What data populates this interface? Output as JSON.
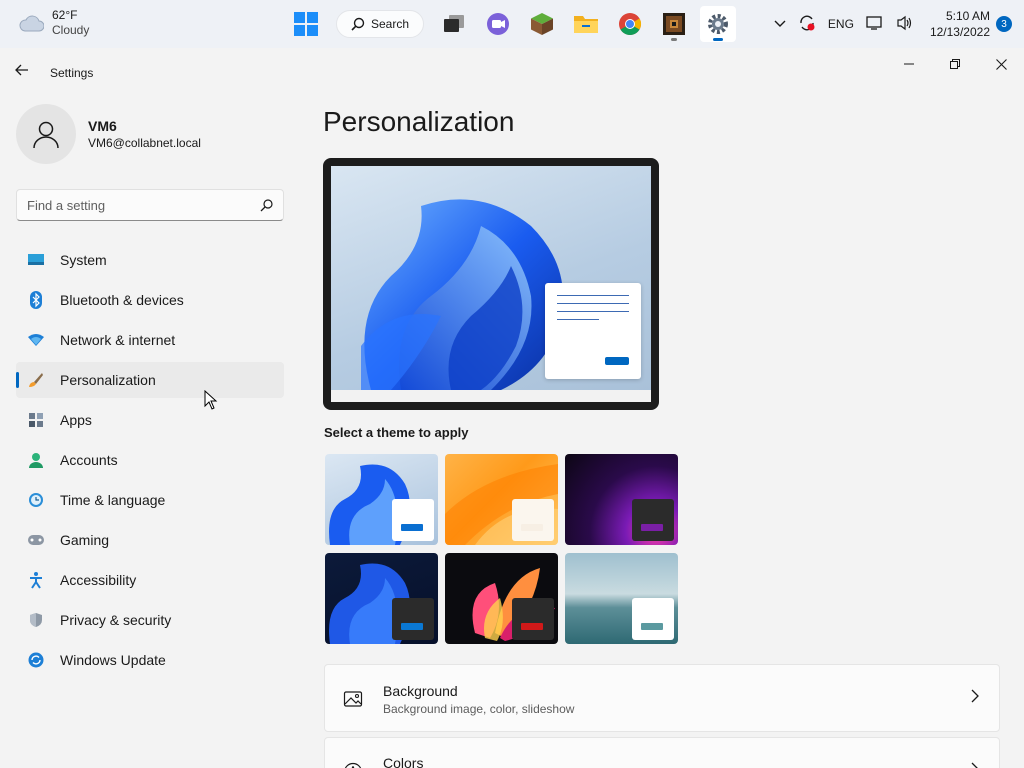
{
  "taskbar": {
    "weather": {
      "temp": "62°F",
      "condition": "Cloudy"
    },
    "search_label": "Search",
    "tray": {
      "language": "ENG",
      "time": "5:10 AM",
      "date": "12/13/2022",
      "notification_count": "3"
    }
  },
  "window": {
    "title": "Settings"
  },
  "profile": {
    "name": "VM6",
    "email": "VM6@collabnet.local"
  },
  "search": {
    "placeholder": "Find a setting"
  },
  "sidebar": {
    "items": [
      {
        "label": "System",
        "icon": "system-icon"
      },
      {
        "label": "Bluetooth & devices",
        "icon": "bluetooth-icon"
      },
      {
        "label": "Network & internet",
        "icon": "wifi-icon"
      },
      {
        "label": "Personalization",
        "icon": "brush-icon",
        "active": true
      },
      {
        "label": "Apps",
        "icon": "apps-icon"
      },
      {
        "label": "Accounts",
        "icon": "accounts-icon"
      },
      {
        "label": "Time & language",
        "icon": "clock-icon"
      },
      {
        "label": "Gaming",
        "icon": "gamepad-icon"
      },
      {
        "label": "Accessibility",
        "icon": "accessibility-icon"
      },
      {
        "label": "Privacy & security",
        "icon": "shield-icon"
      },
      {
        "label": "Windows Update",
        "icon": "update-icon"
      }
    ]
  },
  "main": {
    "title": "Personalization",
    "themes_label": "Select a theme to apply",
    "cards": [
      {
        "title": "Background",
        "subtitle": "Background image, color, slideshow",
        "icon": "image-icon"
      },
      {
        "title": "Colors",
        "subtitle": "",
        "icon": "palette-icon"
      }
    ]
  },
  "colors": {
    "accent": "#0067c0"
  }
}
